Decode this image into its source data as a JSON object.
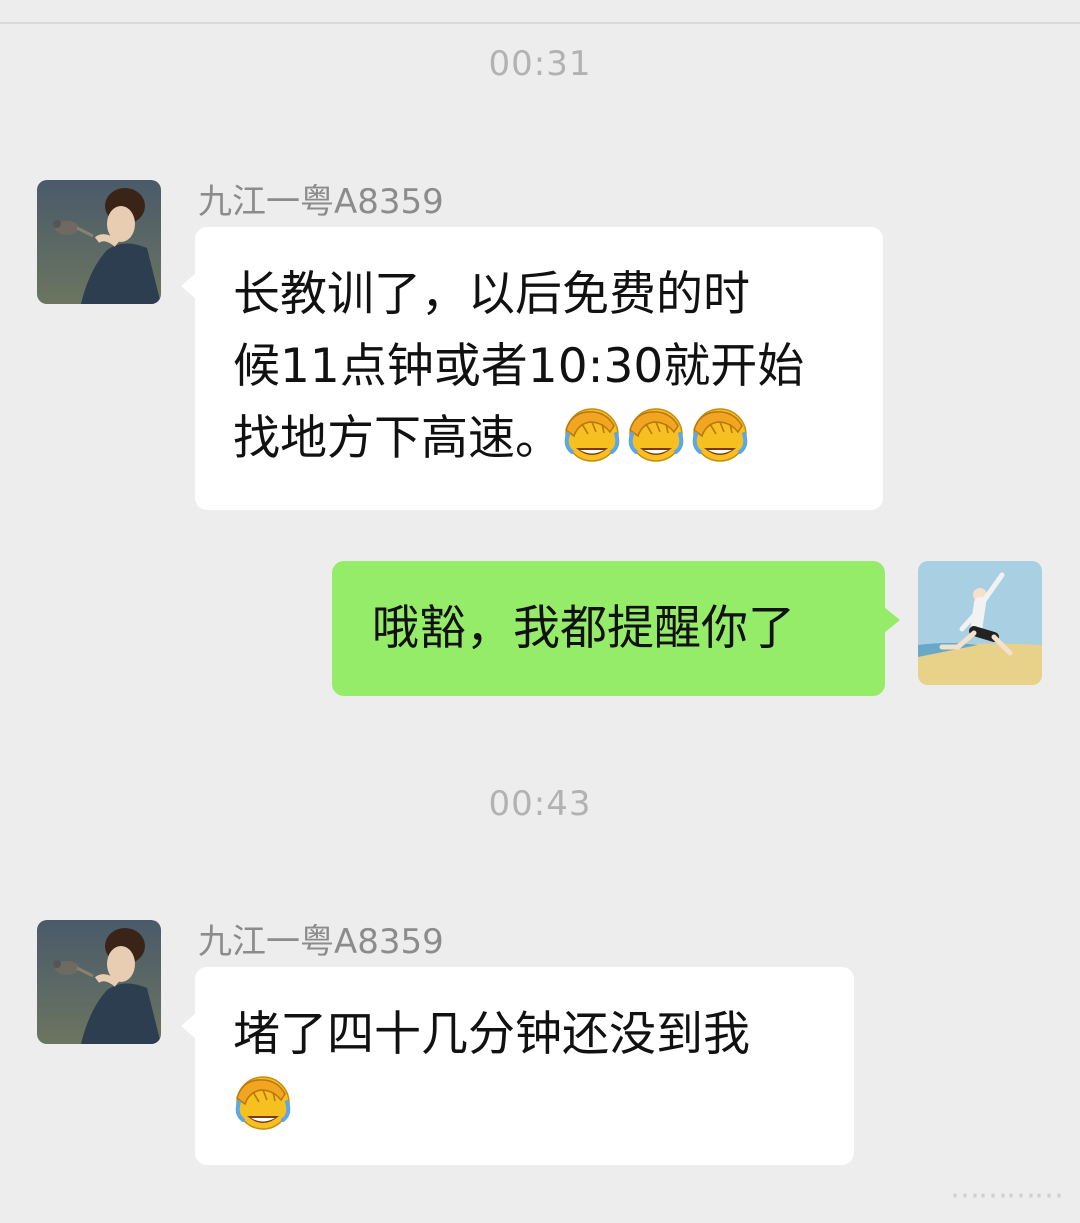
{
  "chat": {
    "time_1": "00:31",
    "time_2": "00:43",
    "msg1": {
      "sender": "九江一粤A8359",
      "lines": [
        "长教训了，以后免费的时",
        "候11点钟或者10:30就开始",
        "找地方下高速。"
      ],
      "emoji_after": [
        "facepalm-cry-emoji",
        "facepalm-cry-emoji",
        "facepalm-cry-emoji"
      ]
    },
    "msg2": {
      "text": "哦豁，我都提醒你了"
    },
    "msg3": {
      "sender": "九江一粤A8359",
      "lines": [
        "堵了四十几分钟还没到我"
      ],
      "emoji_after": [
        "facepalm-cry-emoji"
      ]
    }
  },
  "colors": {
    "background": "#ededed",
    "incoming_bubble": "#ffffff",
    "outgoing_bubble": "#95ec69",
    "timestamp": "#b2b2b2",
    "sender_name": "#8c8c8c"
  },
  "watermark": "⋯⋯⋯⋯"
}
